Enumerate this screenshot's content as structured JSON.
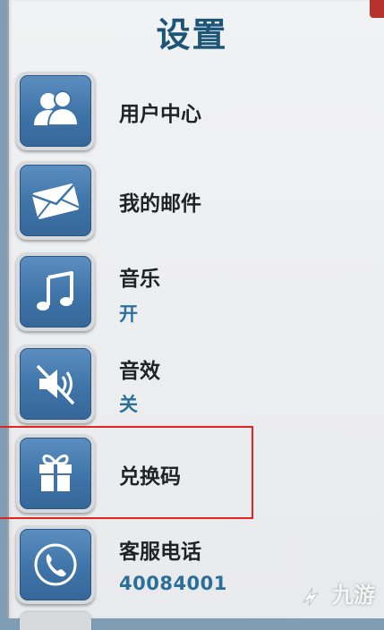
{
  "title": "设置",
  "rows": [
    {
      "label": "用户中心",
      "icon": "user-icon"
    },
    {
      "label": "我的邮件",
      "icon": "mail-icon"
    },
    {
      "label": "音乐",
      "status": "开",
      "icon": "music-note-icon"
    },
    {
      "label": "音效",
      "status": "关",
      "icon": "speaker-muted-icon"
    },
    {
      "label": "兑换码",
      "icon": "gift-icon"
    },
    {
      "label": "客服电话",
      "value": "40084001",
      "icon": "phone-icon"
    }
  ],
  "watermark": "九游",
  "colors": {
    "accent": "#1d5578",
    "tile": "#3f74a8",
    "status": "#2a6f9a",
    "highlight": "#e0251f"
  }
}
